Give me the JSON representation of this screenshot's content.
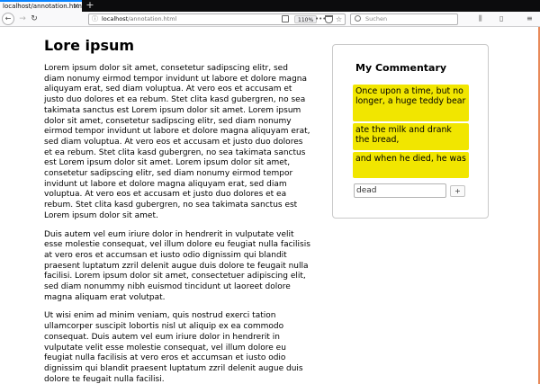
{
  "browser": {
    "tab_title": "localhost/annotation.html",
    "tab_close_icon": "×",
    "new_tab_icon": "+",
    "url_host": "localhost",
    "url_path": "/annotation.html",
    "zoom": "110%",
    "search_placeholder": "Suchen",
    "icons": {
      "back": "←",
      "forward": "→",
      "reload": "↻",
      "info": "ⓘ",
      "more": "•••",
      "star": "☆",
      "library": "⫼",
      "sidebar": "▯",
      "menu": "≡"
    }
  },
  "article": {
    "title": "Lore ipsum",
    "paragraphs": [
      "Lorem ipsum dolor sit amet, consetetur sadipscing elitr, sed diam nonumy eirmod tempor invidunt ut labore et dolore magna aliquyam erat, sed diam voluptua. At vero eos et accusam et justo duo dolores et ea rebum. Stet clita kasd gubergren, no sea takimata sanctus est Lorem ipsum dolor sit amet. Lorem ipsum dolor sit amet, consetetur sadipscing elitr, sed diam nonumy eirmod tempor invidunt ut labore et dolore magna aliquyam erat, sed diam voluptua. At vero eos et accusam et justo duo dolores et ea rebum. Stet clita kasd gubergren, no sea takimata sanctus est Lorem ipsum dolor sit amet. Lorem ipsum dolor sit amet, consetetur sadipscing elitr, sed diam nonumy eirmod tempor invidunt ut labore et dolore magna aliquyam erat, sed diam voluptua. At vero eos et accusam et justo duo dolores et ea rebum. Stet clita kasd gubergren, no sea takimata sanctus est Lorem ipsum dolor sit amet.",
      "Duis autem vel eum iriure dolor in hendrerit in vulputate velit esse molestie consequat, vel illum dolore eu feugiat nulla facilisis at vero eros et accumsan et iusto odio dignissim qui blandit praesent luptatum zzril delenit augue duis dolore te feugait nulla facilisi. Lorem ipsum dolor sit amet, consectetuer adipiscing elit, sed diam nonummy nibh euismod tincidunt ut laoreet dolore magna aliquam erat volutpat.",
      "Ut wisi enim ad minim veniam, quis nostrud exerci tation ullamcorper suscipit lobortis nisl ut aliquip ex ea commodo consequat. Duis autem vel eum iriure dolor in hendrerit in vulputate velit esse molestie consequat, vel illum dolore eu feugiat nulla facilisis at vero eros et accumsan et iusto odio dignissim qui blandit praesent luptatum zzril delenit augue duis dolore te feugait nulla facilisi."
    ]
  },
  "commentary": {
    "title": "My Commentary",
    "notes": [
      "Once upon a time, but no longer, a huge teddy bear",
      "ate the milk and drank the bread,",
      "and when he died, he was"
    ],
    "input_value": "dead",
    "add_label": "+"
  },
  "colors": {
    "highlight": "#f1e600",
    "tab_accent": "#0a84ff",
    "window_accent": "#e88a5a"
  }
}
